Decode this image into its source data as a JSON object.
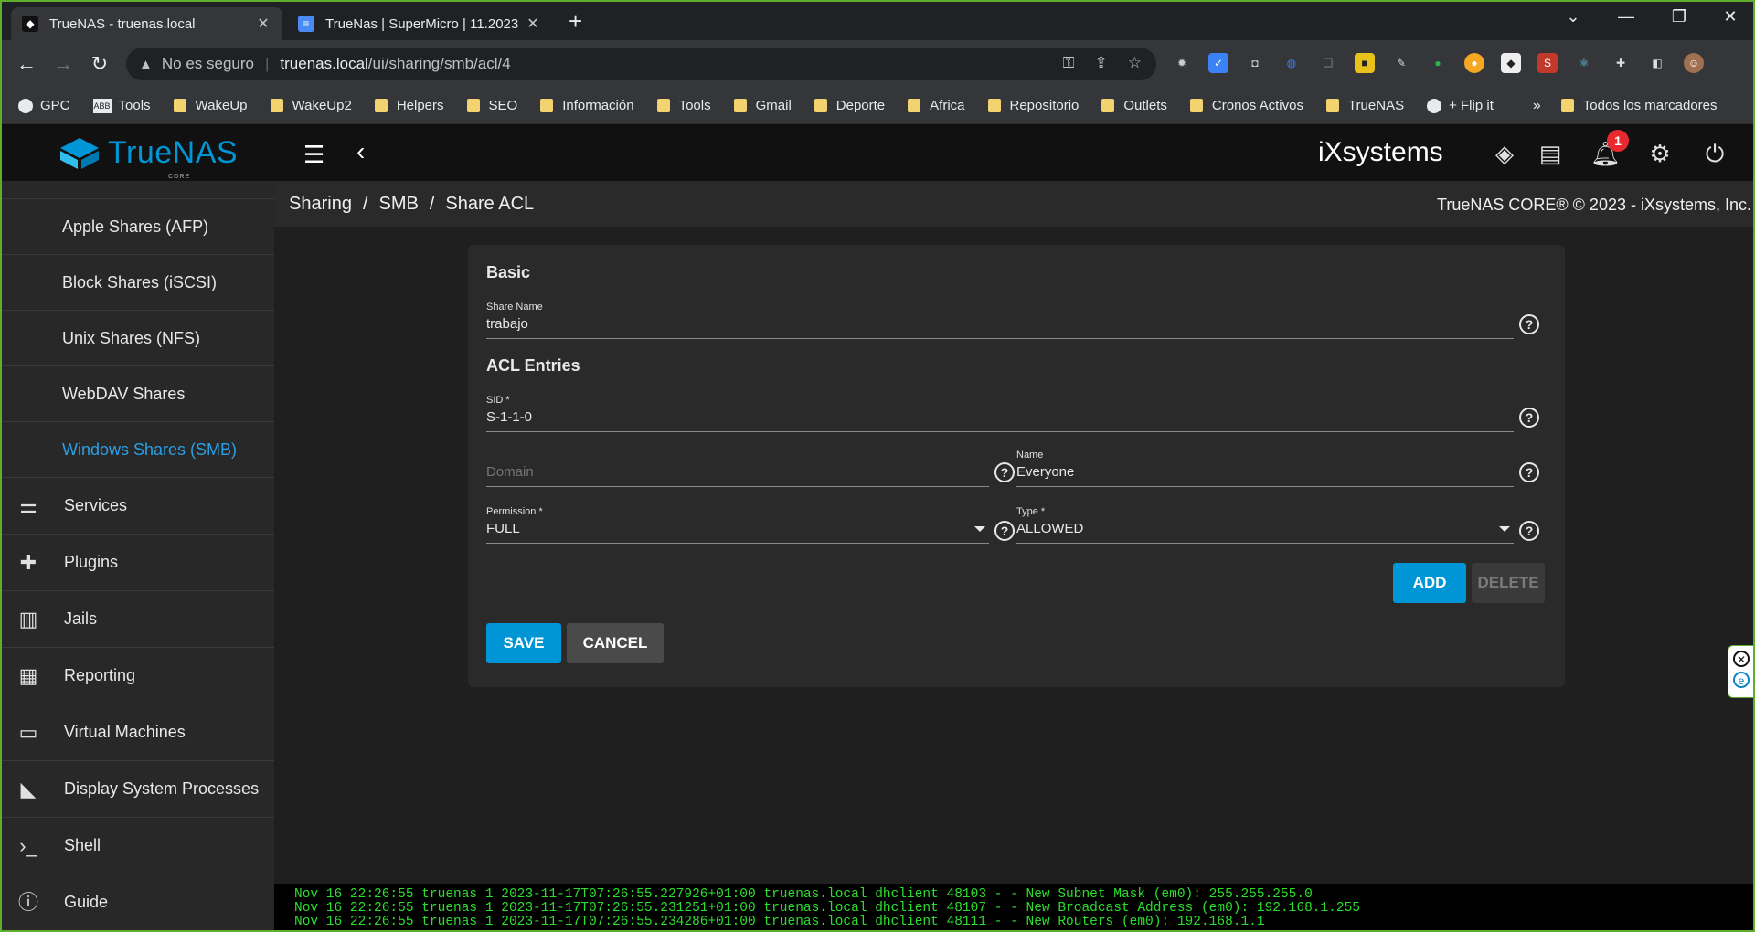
{
  "browser": {
    "tabs": [
      {
        "title": "TrueNAS - truenas.local"
      },
      {
        "title": "TrueNas | SuperMicro | 11.2023"
      }
    ],
    "url": {
      "warning": "No es seguro",
      "host": "truenas.local",
      "path": "/ui/sharing/smb/acl/4"
    },
    "bookmarks": [
      "GPC",
      "Tools",
      "WakeUp",
      "WakeUp2",
      "Helpers",
      "SEO",
      "Información",
      "Tools",
      "Gmail",
      "Deporte",
      "Africa",
      "Repositorio",
      "Outlets",
      "Cronos Activos",
      "TrueNAS",
      "+ Flip it"
    ],
    "all_bookmarks": "Todos los marcadores",
    "bm_tools_ico": "ABB"
  },
  "app": {
    "logo": {
      "brand": "TrueNAS",
      "edition": "CORE"
    },
    "vendor": "iXsystems",
    "notifications_count": "1",
    "sidebar": {
      "sub_items": [
        "Apple Shares (AFP)",
        "Block Shares (iSCSI)",
        "Unix Shares (NFS)",
        "WebDAV Shares",
        "Windows Shares (SMB)"
      ],
      "items": [
        "Services",
        "Plugins",
        "Jails",
        "Reporting",
        "Virtual Machines",
        "Display System Processes",
        "Shell",
        "Guide"
      ]
    },
    "breadcrumb": [
      "Sharing",
      "SMB",
      "Share ACL"
    ],
    "copyright": "TrueNAS CORE® © 2023 - iXsystems, Inc.",
    "form": {
      "basic_title": "Basic",
      "share_name": {
        "label": "Share Name",
        "value": "trabajo"
      },
      "acl_title": "ACL Entries",
      "sid": {
        "label": "SID *",
        "value": "S-1-1-0"
      },
      "domain": {
        "placeholder": "Domain",
        "value": ""
      },
      "name": {
        "label": "Name",
        "value": "Everyone"
      },
      "permission": {
        "label": "Permission *",
        "value": "FULL"
      },
      "type": {
        "label": "Type *",
        "value": "ALLOWED"
      },
      "add_label": "ADD",
      "delete_label": "DELETE",
      "save_label": "SAVE",
      "cancel_label": "CANCEL"
    },
    "console": [
      "Nov 16 22:26:55 truenas 1 2023-11-17T07:26:55.227926+01:00 truenas.local dhclient 48103 - - New Subnet Mask (em0): 255.255.255.0",
      "Nov 16 22:26:55 truenas 1 2023-11-17T07:26:55.231251+01:00 truenas.local dhclient 48107 - - New Broadcast Address (em0): 192.168.1.255",
      "Nov 16 22:26:55 truenas 1 2023-11-17T07:26:55.234286+01:00 truenas.local dhclient 48111 - - New Routers (em0): 192.168.1.1"
    ]
  },
  "colors": {
    "accent": "#0095d5",
    "active_nav": "#2b9fe6",
    "badge": "#e8292f",
    "console_text": "#2cde2c"
  }
}
